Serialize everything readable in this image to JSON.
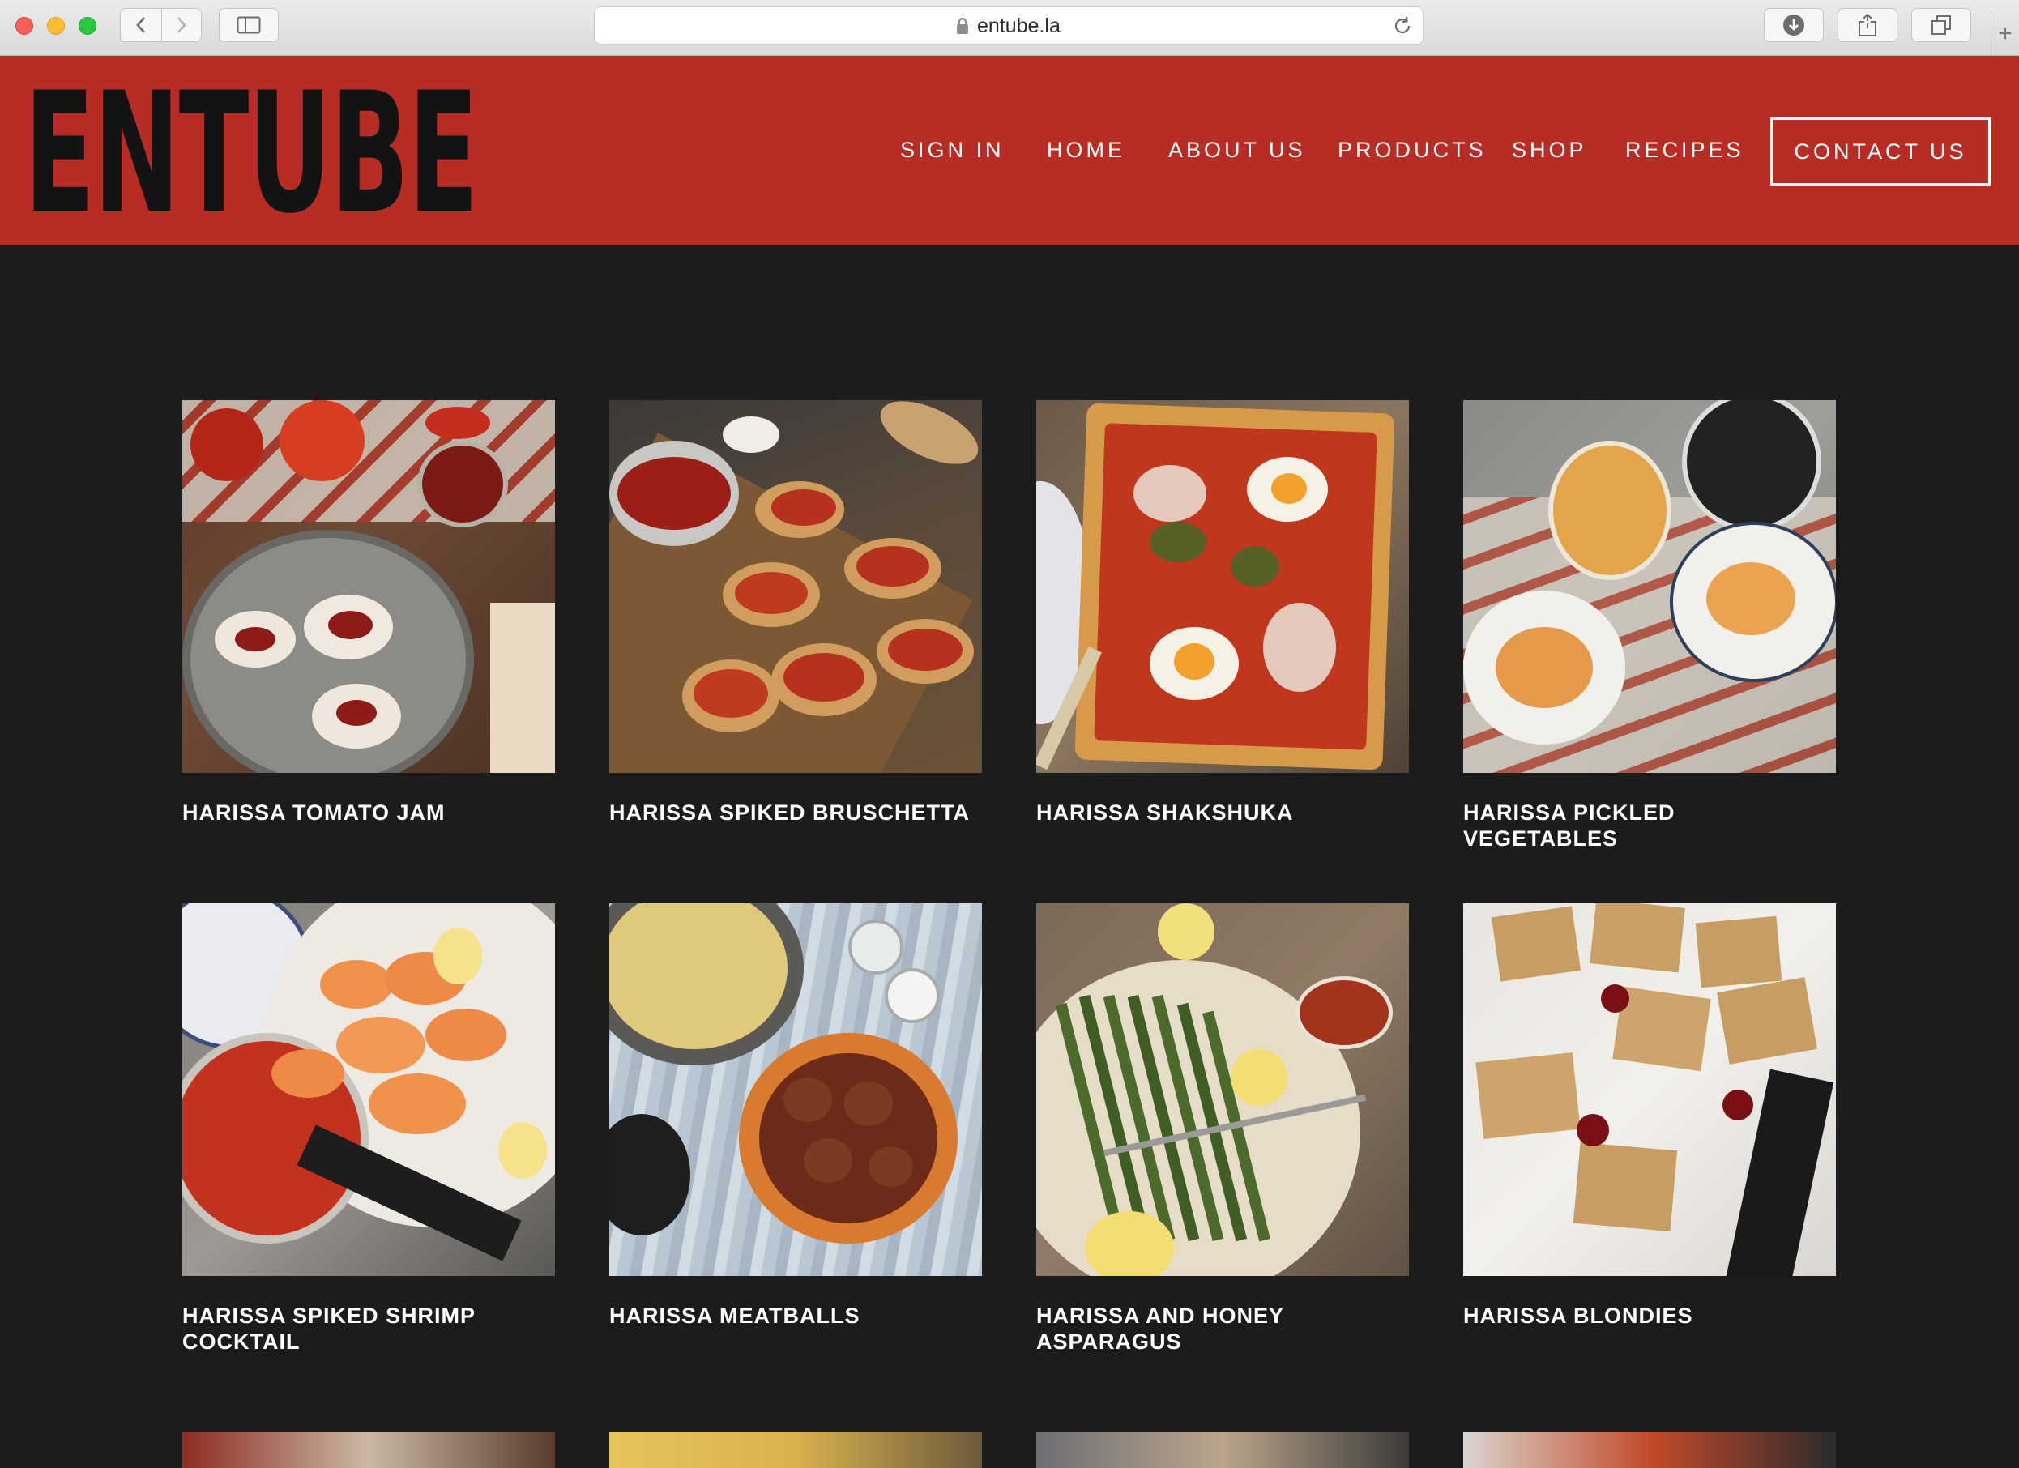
{
  "browser": {
    "url": "entube.la"
  },
  "site": {
    "logo": "ENTUBE",
    "nav": [
      "SIGN IN",
      "HOME",
      "ABOUT US",
      "PRODUCTS",
      "SHOP",
      "RECIPES"
    ],
    "contact": "CONTACT US",
    "brand_color": "#b72c25",
    "background_color": "#1c1c1c"
  },
  "recipes": [
    {
      "title": "HARISSA TOMATO JAM"
    },
    {
      "title": "HARISSA SPIKED BRUSCHETTA"
    },
    {
      "title": "HARISSA SHAKSHUKA"
    },
    {
      "title": "HARISSA PICKLED VEGETABLES"
    },
    {
      "title": "HARISSA SPIKED SHRIMP COCKTAIL"
    },
    {
      "title": "HARISSA MEATBALLS"
    },
    {
      "title": "HARISSA AND HONEY ASPARAGUS"
    },
    {
      "title": "HARISSA BLONDIES"
    }
  ]
}
